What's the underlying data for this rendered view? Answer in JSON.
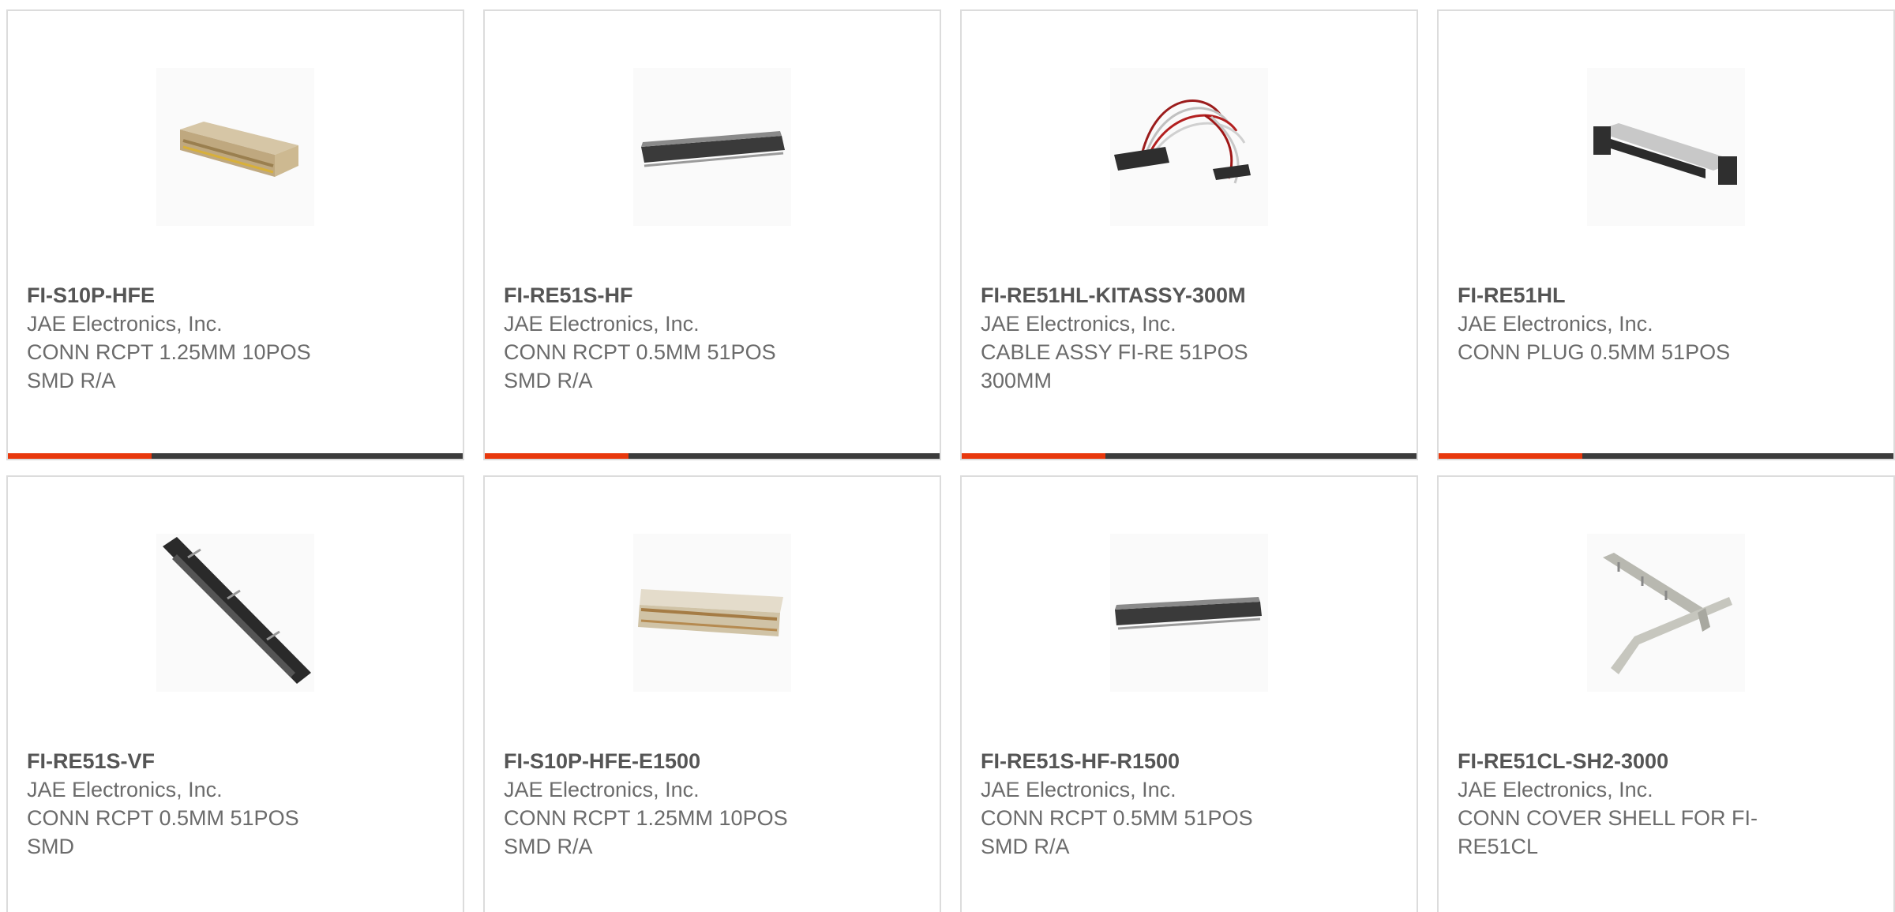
{
  "products": [
    {
      "part": "FI-S10P-HFE",
      "manufacturer": "JAE Electronics, Inc.",
      "description": "CONN RCPT 1.25MM 10POS\nSMD R/A",
      "image_icon": "beige-connector-icon"
    },
    {
      "part": "FI-RE51S-HF",
      "manufacturer": "JAE Electronics, Inc.",
      "description": "CONN RCPT 0.5MM 51POS\nSMD R/A",
      "image_icon": "dark-connector-icon"
    },
    {
      "part": "FI-RE51HL-KITASSY-300M",
      "manufacturer": "JAE Electronics, Inc.",
      "description": "CABLE ASSY FI-RE 51POS\n300MM",
      "image_icon": "cable-assembly-icon"
    },
    {
      "part": "FI-RE51HL",
      "manufacturer": "JAE Electronics, Inc.",
      "description": "CONN PLUG 0.5MM 51POS",
      "image_icon": "plug-connector-icon"
    },
    {
      "part": "FI-RE51S-VF",
      "manufacturer": "JAE Electronics, Inc.",
      "description": "CONN RCPT 0.5MM 51POS\nSMD",
      "image_icon": "vertical-connector-icon"
    },
    {
      "part": "FI-S10P-HFE-E1500",
      "manufacturer": "JAE Electronics, Inc.",
      "description": "CONN RCPT 1.25MM 10POS\nSMD R/A",
      "image_icon": "beige-connector-icon"
    },
    {
      "part": "FI-RE51S-HF-R1500",
      "manufacturer": "JAE Electronics, Inc.",
      "description": "CONN RCPT 0.5MM 51POS\nSMD R/A",
      "image_icon": "dark-connector-icon"
    },
    {
      "part": "FI-RE51CL-SH2-3000",
      "manufacturer": "JAE Electronics, Inc.",
      "description": "CONN COVER SHELL FOR FI-\nRE51CL",
      "image_icon": "cover-shell-icon"
    }
  ],
  "colors": {
    "accent": "#e8380d",
    "bar": "#3c3c3c",
    "border": "#dcdcdc",
    "text": "#6b6b6b"
  }
}
